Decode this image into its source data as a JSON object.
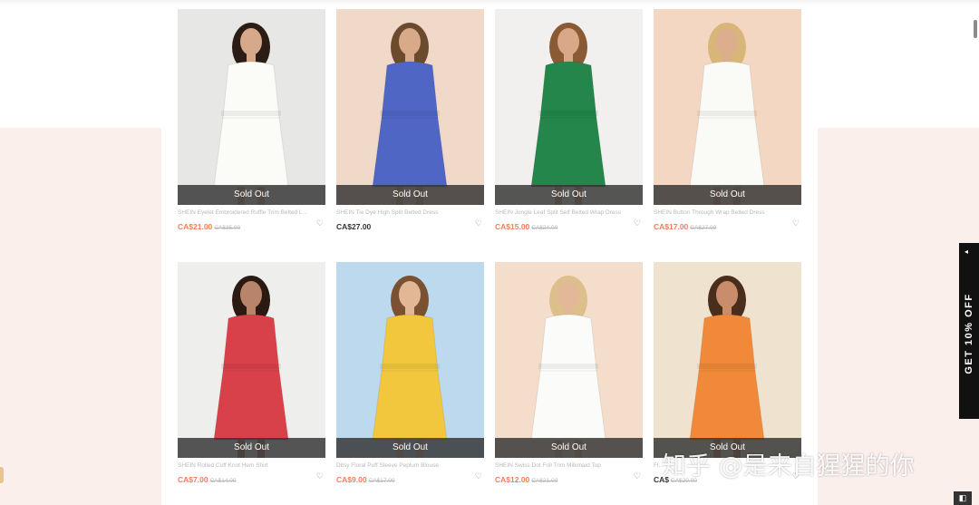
{
  "products": [
    {
      "name": "SHEIN Eyelet Embroidered Ruffle Trim Belted L...",
      "price": "CA$21.00",
      "original_price": "CA$35.00",
      "on_sale": true,
      "status": "Sold Out",
      "colors": {
        "bg": "#e7e7e5",
        "garment": "#fbfbf8",
        "skin": "#d6a98b",
        "hair": "#2b1d16"
      }
    },
    {
      "name": "SHEIN Tie Dye High Split Belted Dress",
      "price": "CA$27.00",
      "original_price": "",
      "on_sale": false,
      "status": "Sold Out",
      "colors": {
        "bg": "#f1d9c9",
        "garment": "#4f66c4",
        "skin": "#d9aa8a",
        "hair": "#6b4a2e"
      }
    },
    {
      "name": "SHEIN Jungle Leaf Split Self Belted Wrap Dress",
      "price": "CA$15.00",
      "original_price": "CA$24.00",
      "on_sale": true,
      "status": "Sold Out",
      "colors": {
        "bg": "#f1f0ef",
        "garment": "#24864a",
        "skin": "#d8a888",
        "hair": "#8a5a35"
      }
    },
    {
      "name": "SHEIN Button Through Wrap Belted Dress",
      "price": "CA$17.00",
      "original_price": "CA$27.00",
      "on_sale": true,
      "status": "Sold Out",
      "colors": {
        "bg": "#f3d7c2",
        "garment": "#fafaf7",
        "skin": "#dcae8e",
        "hair": "#d8b679"
      }
    },
    {
      "name": "SHEIN Rolled Cuff Knot Hem Shirt",
      "price": "CA$7.00",
      "original_price": "CA$14.00",
      "on_sale": true,
      "status": "Sold Out",
      "colors": {
        "bg": "#eeeeec",
        "garment": "#d9414a",
        "skin": "#b8856a",
        "hair": "#2a1a12"
      }
    },
    {
      "name": "Ditsy Floral Puff Sleeve Peplum Blouse",
      "price": "CA$9.00",
      "original_price": "CA$17.00",
      "on_sale": true,
      "status": "Sold Out",
      "colors": {
        "bg": "#bcd9ee",
        "garment": "#f2c73e",
        "skin": "#e2b796",
        "hair": "#7a5233"
      }
    },
    {
      "name": "SHEIN Swiss Dot Frill Trim Milkmaid Top",
      "price": "CA$12.00",
      "original_price": "CA$21.00",
      "on_sale": true,
      "status": "Sold Out",
      "colors": {
        "bg": "#f4ddca",
        "garment": "#fbfbf9",
        "skin": "#e3b898",
        "hair": "#dcbf8a"
      }
    },
    {
      "name": "Fl...",
      "price": "CA$",
      "original_price": "CA$20.00",
      "on_sale": false,
      "status": "Sold Out",
      "colors": {
        "bg": "#efe2cf",
        "garment": "#f08a3a",
        "skin": "#c98d6c",
        "hair": "#4a2e1c"
      }
    }
  ],
  "promo": {
    "text": "GET 10% OFF",
    "arrow": "◂"
  },
  "watermark": "知乎 @是来自猩猩的你",
  "icons": {
    "heart": "♡",
    "corner": "◧"
  }
}
